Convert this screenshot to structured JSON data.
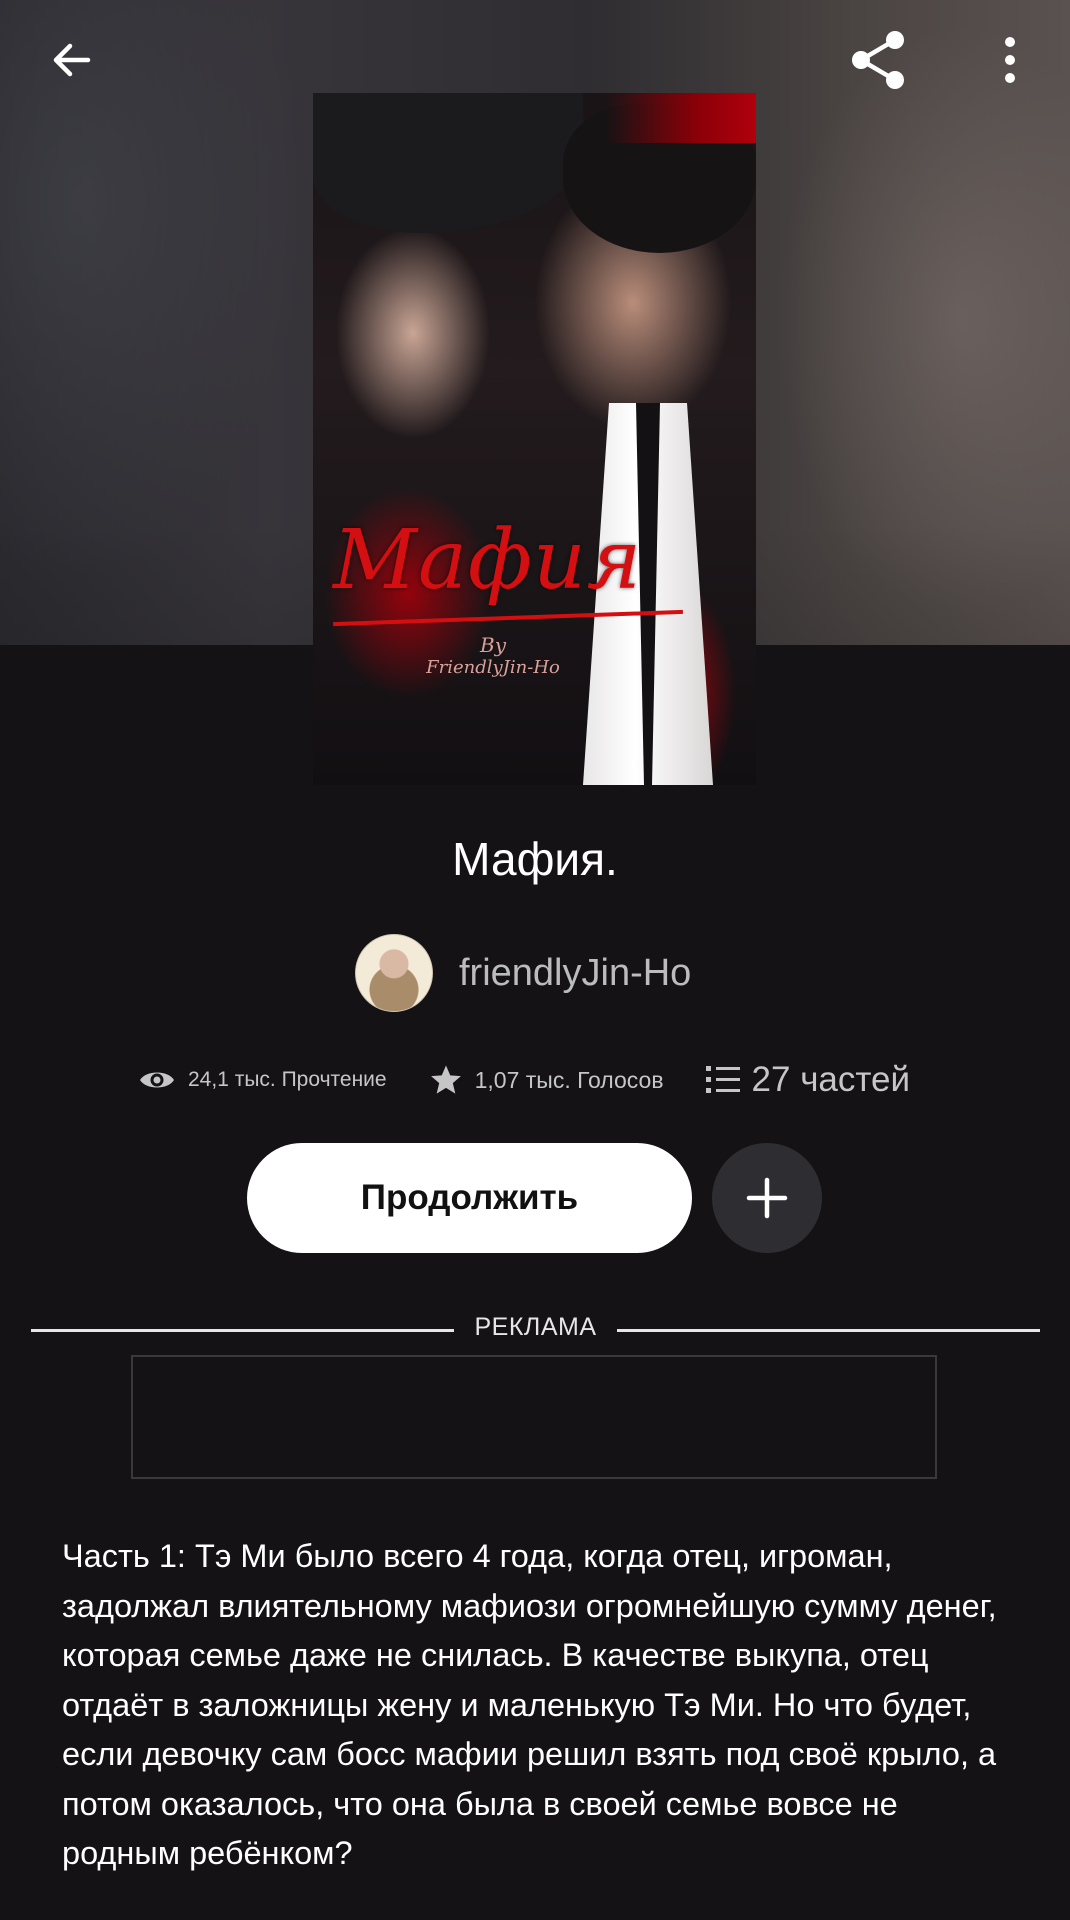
{
  "header": {
    "back_icon": "arrow-left-icon",
    "share_icon": "share-icon",
    "more_icon": "vertical-dots-icon"
  },
  "cover": {
    "title_text": "Мафия",
    "by_text": "By",
    "author_text": "FriendlyJin-Ho",
    "accent_color": "#d40f12"
  },
  "story": {
    "title": "Мафия.",
    "author": "friendlyJin-Ho"
  },
  "stats": {
    "reads": "24,1 тыс. Прочтение",
    "votes": "1,07 тыс. Голосов",
    "parts": "27 частей",
    "reads_icon": "eye-icon",
    "votes_icon": "star-icon",
    "parts_icon": "list-icon"
  },
  "actions": {
    "continue_label": "Продолжить",
    "add_icon": "plus-icon"
  },
  "ad": {
    "label": "РЕКЛАМА"
  },
  "description": "Часть 1: Тэ Ми было всего 4 года, когда отец, игроман, задолжал влиятельному мафиози огромнейшую сумму денег, которая семье даже не снилась. В качестве выкупа, отец отдаёт в заложницы жену и маленькую Тэ Ми. Но что будет, если девочку сам босс мафии решил взять под своё крыло, а потом оказалось, что она была в своей семье вовсе не родным ребёнком?"
}
